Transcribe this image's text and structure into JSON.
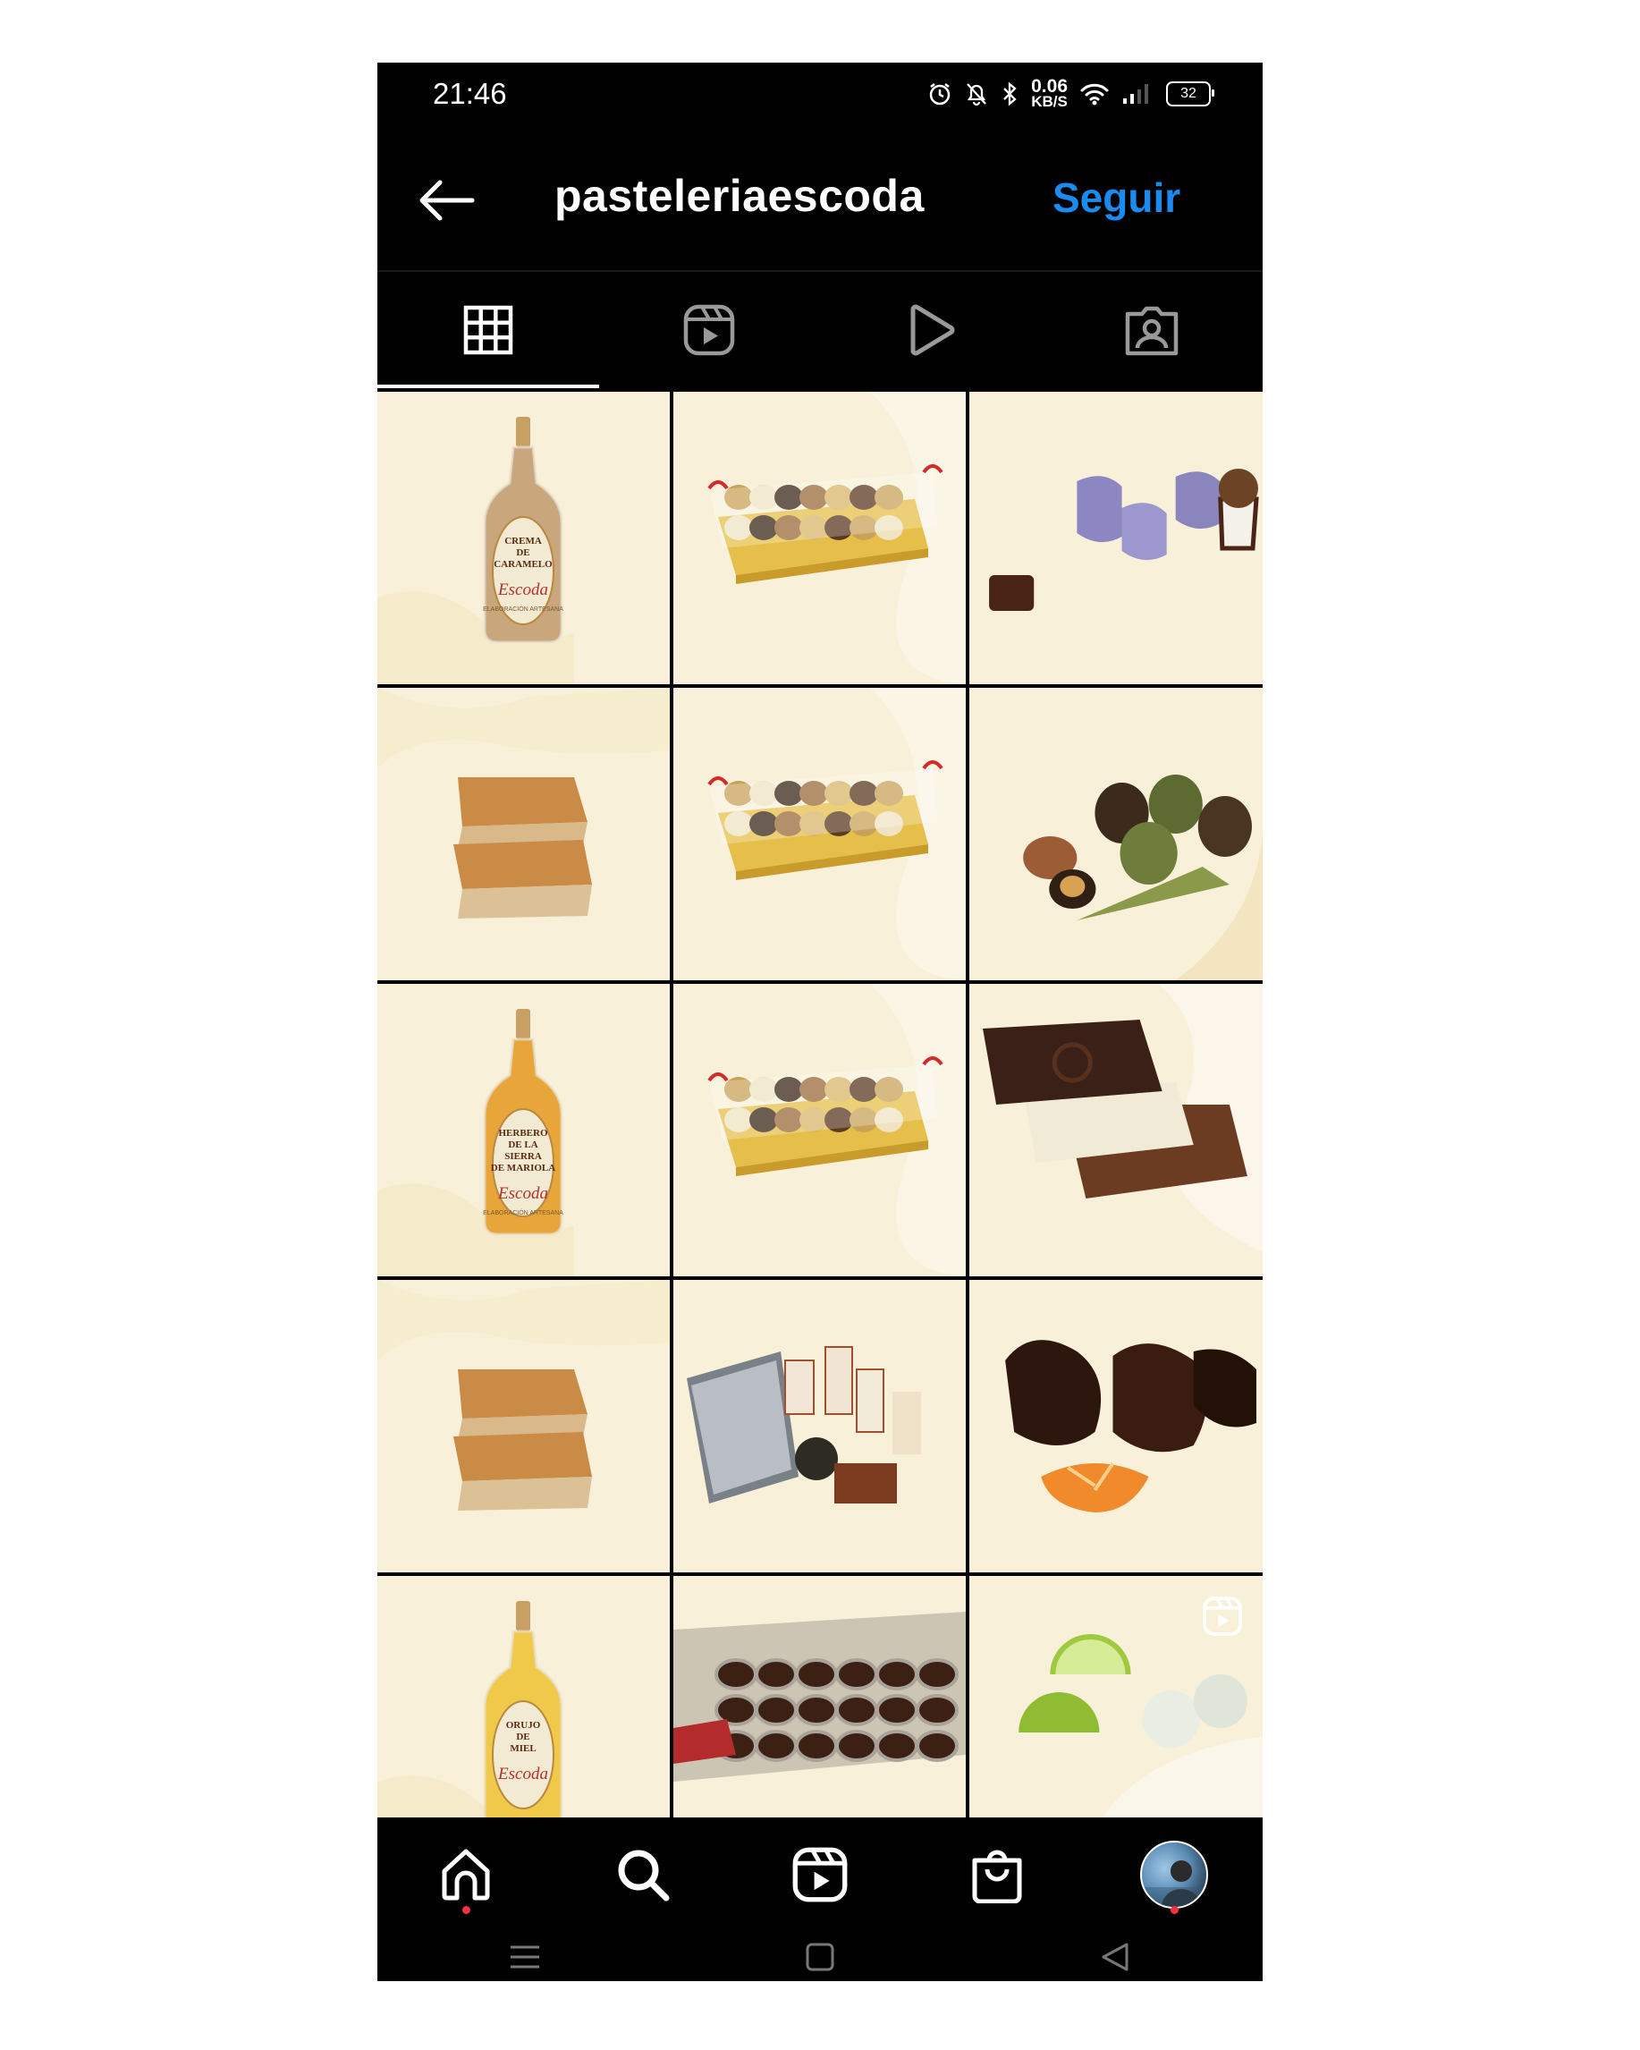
{
  "status_bar": {
    "time": "21:46",
    "net_speed_value": "0.06",
    "net_speed_unit": "KB/S",
    "battery": "32",
    "icons": [
      "alarm-icon",
      "mute-icon",
      "bluetooth-icon",
      "wifi-icon",
      "signal-icon",
      "battery-icon"
    ]
  },
  "header": {
    "back_icon": "arrow-left-icon",
    "username": "pasteleriaescoda",
    "follow_label": "Seguir",
    "follow_color": "#1a8cf0"
  },
  "tabs": [
    {
      "icon": "grid-icon",
      "active": true
    },
    {
      "icon": "reels-icon",
      "active": false
    },
    {
      "icon": "play-icon",
      "active": false
    },
    {
      "icon": "tagged-icon",
      "active": false
    }
  ],
  "grid": {
    "posts": [
      {
        "subject": "caramel-liqueur-bottle",
        "label_lines": [
          "CREMA",
          "DE",
          "CARAMELO"
        ],
        "brand": "Escoda",
        "sub": "ELABORACIÓN ARTESANA"
      },
      {
        "subject": "gift-tray"
      },
      {
        "subject": "coconut-sweets"
      },
      {
        "subject": "sponge-cake"
      },
      {
        "subject": "gift-tray"
      },
      {
        "subject": "chocolate-almonds"
      },
      {
        "subject": "herbs-liqueur-bottle",
        "label_lines": [
          "HERBERO",
          "DE LA",
          "SIERRA",
          "DE MARIOLA"
        ],
        "brand": "Escoda",
        "sub": "ELABORACIÓN ARTESANA"
      },
      {
        "subject": "gift-tray"
      },
      {
        "subject": "chocolate-bars"
      },
      {
        "subject": "sponge-cake"
      },
      {
        "subject": "gift-box"
      },
      {
        "subject": "chocolate-rocks"
      },
      {
        "subject": "honey-liqueur-bottle",
        "label_lines": [
          "ORUJO",
          "DE",
          "MIEL"
        ],
        "brand": "Escoda"
      },
      {
        "subject": "chocolate-cups-tray"
      },
      {
        "subject": "lime-truffles",
        "badge": "reels-icon"
      }
    ]
  },
  "bottom_nav": [
    {
      "icon": "home-icon",
      "notification_dot": true
    },
    {
      "icon": "search-icon",
      "notification_dot": false
    },
    {
      "icon": "reels-icon",
      "notification_dot": false
    },
    {
      "icon": "shop-icon",
      "notification_dot": false
    },
    {
      "icon": "profile-avatar",
      "notification_dot": true
    }
  ],
  "system_nav": [
    "menu-icon",
    "home-square-icon",
    "back-triangle-icon"
  ]
}
